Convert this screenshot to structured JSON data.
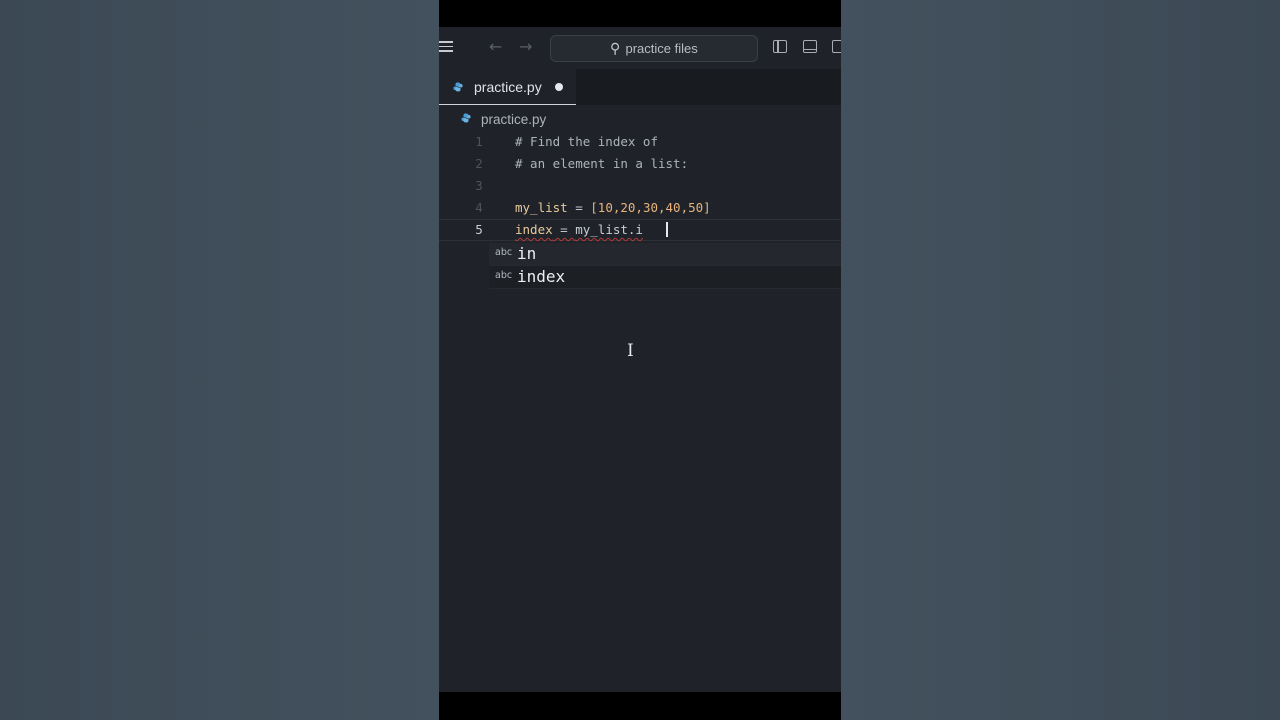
{
  "window": {
    "search_label": "practice files"
  },
  "tab": {
    "label": "practice.py",
    "modified": true
  },
  "breadcrumb": {
    "file": "practice.py"
  },
  "editor": {
    "lines": [
      {
        "number": "1",
        "text": "# Find the index of"
      },
      {
        "number": "2",
        "text": "# an element in a list:"
      },
      {
        "number": "3",
        "text": ""
      },
      {
        "number": "4",
        "var": "my_list",
        "op": " = ",
        "value": "[10,20,30,40,50]"
      },
      {
        "number": "5",
        "var": "index",
        "op": " = ",
        "value": "my_list.i"
      }
    ],
    "active_line": "5"
  },
  "suggestions": [
    {
      "kind": "abc",
      "label": "in"
    },
    {
      "kind": "abc",
      "label": "index"
    }
  ],
  "colors": {
    "editor_bg": "#1f2329",
    "accent_python": "#4a9bd4",
    "error_squiggle": "#b33a3a"
  }
}
